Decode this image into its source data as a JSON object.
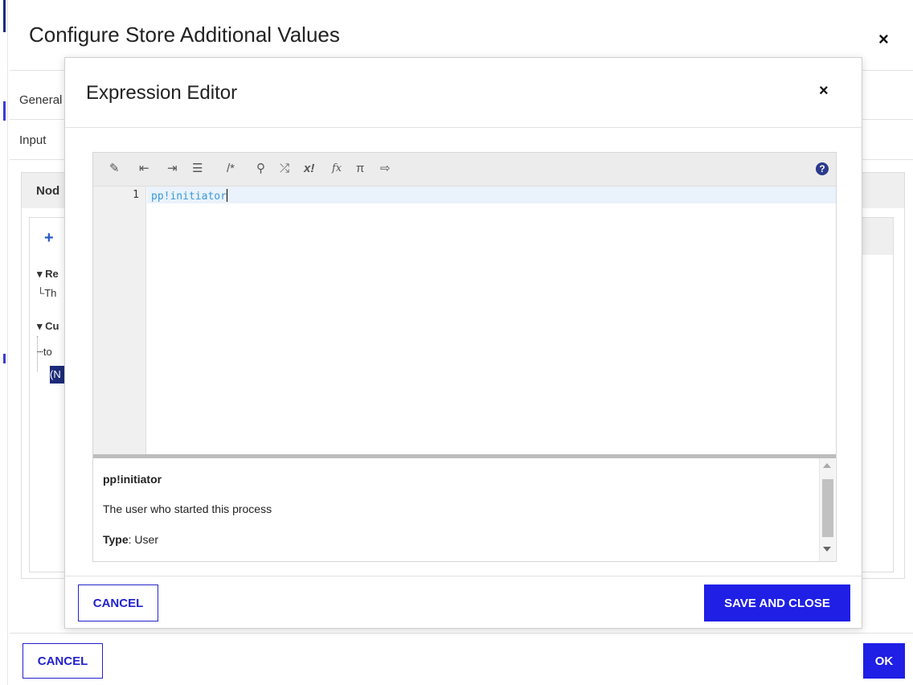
{
  "outer_dialog": {
    "title": "Configure Store Additional Values",
    "close_icon": "×",
    "tabs": [
      "General",
      "Input"
    ],
    "section_title": "Nod",
    "tree": {
      "add_icon": "+",
      "items": [
        {
          "label": "Re",
          "bold": true
        },
        {
          "label": "Th",
          "bold": false
        },
        {
          "label": "Cu",
          "bold": true
        },
        {
          "label": "to",
          "bold": false
        },
        {
          "label": "(N",
          "bold": false,
          "selected": true
        }
      ]
    },
    "cancel_label": "CANCEL",
    "ok_label": "OK"
  },
  "modal": {
    "title": "Expression Editor",
    "close_icon": "×",
    "toolbar": {
      "icons": [
        {
          "name": "magic-wand-icon",
          "glyph": "✎"
        },
        {
          "name": "outdent-icon",
          "glyph": "⇤"
        },
        {
          "name": "indent-icon",
          "glyph": "⇥"
        },
        {
          "name": "format-lines-icon",
          "glyph": "☰"
        },
        {
          "name": "comment-icon",
          "glyph": "/*"
        },
        {
          "name": "search-icon",
          "glyph": "⚲"
        },
        {
          "name": "shuffle-icon",
          "glyph": "⤮"
        },
        {
          "name": "rule-icon",
          "glyph": "x!"
        },
        {
          "name": "function-icon",
          "glyph": "fx"
        },
        {
          "name": "pi-icon",
          "glyph": "π"
        },
        {
          "name": "export-icon",
          "glyph": "⇨"
        }
      ],
      "help_icon": "?"
    },
    "editor": {
      "line_number": "1",
      "code": "pp!initiator"
    },
    "doc": {
      "name": "pp!initiator",
      "description": "The user who started this process",
      "type_label": "Type",
      "type_value": ": User"
    },
    "cancel_label": "CANCEL",
    "save_label": "SAVE AND CLOSE"
  },
  "colors": {
    "primary": "#1f1fe6",
    "code_text": "#3a9bd8",
    "selection": "#1d2b7a"
  }
}
